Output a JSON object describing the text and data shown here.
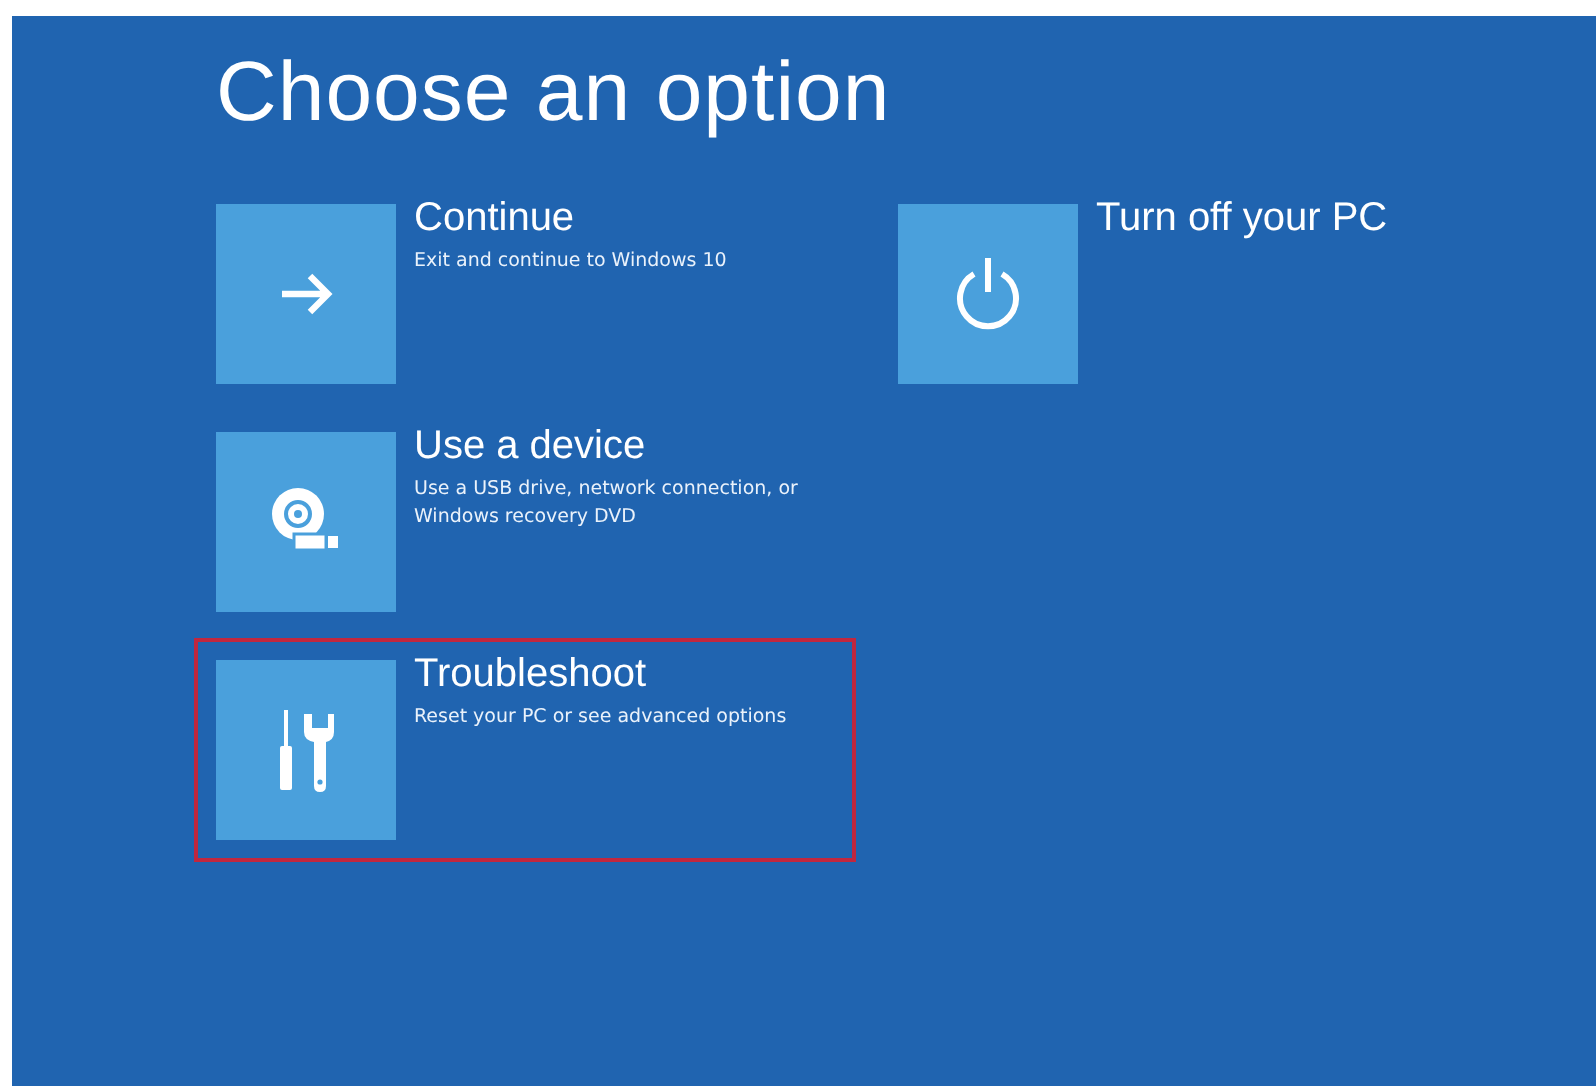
{
  "title": "Choose an option",
  "columns": [
    {
      "options": [
        {
          "kind": "arrow",
          "title": "Continue",
          "description": "Exit and continue to Windows 10",
          "highlighted": false
        },
        {
          "kind": "device",
          "title": "Use a device",
          "description": "Use a USB drive, network connection, or Windows recovery DVD",
          "highlighted": false
        },
        {
          "kind": "tools",
          "title": "Troubleshoot",
          "description": "Reset your PC or see advanced options",
          "highlighted": true
        }
      ]
    },
    {
      "options": [
        {
          "kind": "power",
          "title": "Turn off your PC",
          "highlighted": false
        }
      ]
    }
  ]
}
